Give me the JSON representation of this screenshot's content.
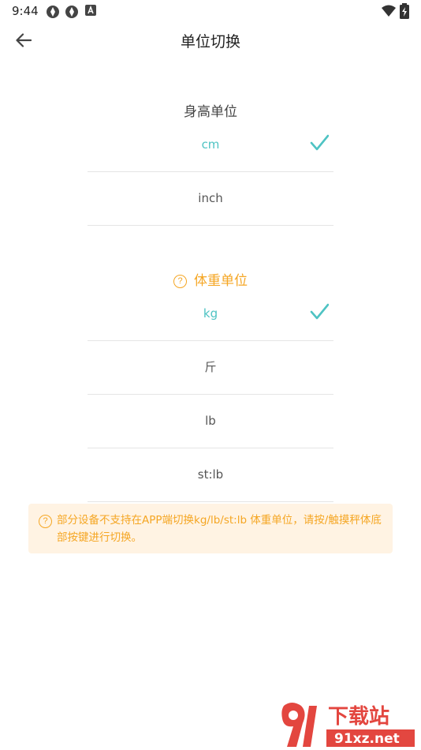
{
  "status_bar": {
    "time": "9:44"
  },
  "header": {
    "title": "单位切换",
    "back_icon": "arrow-left-icon"
  },
  "height_section": {
    "title": "身高单位",
    "options": [
      {
        "label": "cm",
        "selected": true
      },
      {
        "label": "inch",
        "selected": false
      }
    ]
  },
  "weight_section": {
    "title": "体重单位",
    "help_icon": "question-circle-icon",
    "options": [
      {
        "label": "kg",
        "selected": true
      },
      {
        "label": "斤",
        "selected": false
      },
      {
        "label": "lb",
        "selected": false
      },
      {
        "label": "st:lb",
        "selected": false
      }
    ]
  },
  "notice": {
    "text": "部分设备不支持在APP端切换kg/lb/st:lb 体重单位，请按/触摸秤体底部按键进行切换。"
  },
  "watermark": {
    "brand": "下载站",
    "domain": "91xz.net"
  },
  "colors": {
    "accent": "#4ec3c3",
    "warning": "#f5a623",
    "notice_bg": "#fff3e3",
    "divider": "#e5e5e5"
  }
}
